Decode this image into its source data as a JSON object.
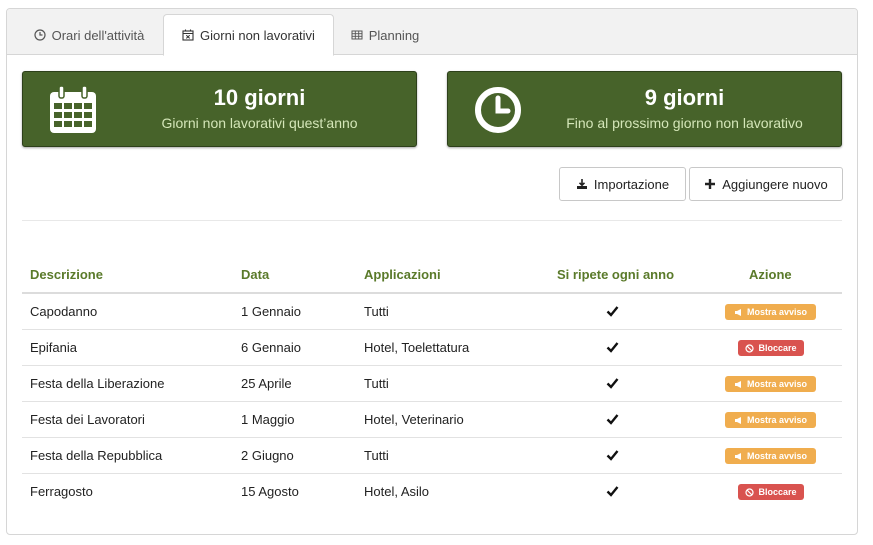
{
  "colors": {
    "accent_green": "#47632a",
    "header_green": "#5a7a2a",
    "warning": "#f0ad4e",
    "danger": "#d9534f"
  },
  "tabs": [
    {
      "label": "Orari dell'attività",
      "icon": "clock-icon",
      "active": false
    },
    {
      "label": "Giorni non lavorativi",
      "icon": "calendar-x-icon",
      "active": true
    },
    {
      "label": "Planning",
      "icon": "table-icon",
      "active": false
    }
  ],
  "stats": [
    {
      "value": "10 giorni",
      "label": "Giorni non lavorativi quest’anno",
      "icon": "calendar-icon"
    },
    {
      "value": "9 giorni",
      "label": "Fino al prossimo giorno non lavorativo",
      "icon": "clock-icon"
    }
  ],
  "toolbar": {
    "import_label": "Importazione",
    "add_label": "Aggiungere nuovo"
  },
  "table": {
    "headers": [
      "Descrizione",
      "Data",
      "Applicazioni",
      "Si ripete ogni anno",
      "Azione"
    ],
    "rows": [
      {
        "descrizione": "Capodanno",
        "data": "1 Gennaio",
        "applicazioni": "Tutti",
        "ripete": true,
        "azione": "Mostra avviso",
        "azione_tipo": "warning"
      },
      {
        "descrizione": "Epifania",
        "data": "6 Gennaio",
        "applicazioni": "Hotel, Toelettatura",
        "ripete": true,
        "azione": "Bloccare",
        "azione_tipo": "danger"
      },
      {
        "descrizione": "Festa della Liberazione",
        "data": "25 Aprile",
        "applicazioni": "Tutti",
        "ripete": true,
        "azione": "Mostra avviso",
        "azione_tipo": "warning"
      },
      {
        "descrizione": "Festa dei Lavoratori",
        "data": "1 Maggio",
        "applicazioni": "Hotel, Veterinario",
        "ripete": true,
        "azione": "Mostra avviso",
        "azione_tipo": "warning"
      },
      {
        "descrizione": "Festa della Repubblica",
        "data": "2 Giugno",
        "applicazioni": "Tutti",
        "ripete": true,
        "azione": "Mostra avviso",
        "azione_tipo": "warning"
      },
      {
        "descrizione": "Ferragosto",
        "data": "15 Agosto",
        "applicazioni": "Hotel, Asilo",
        "ripete": true,
        "azione": "Bloccare",
        "azione_tipo": "danger"
      }
    ]
  }
}
